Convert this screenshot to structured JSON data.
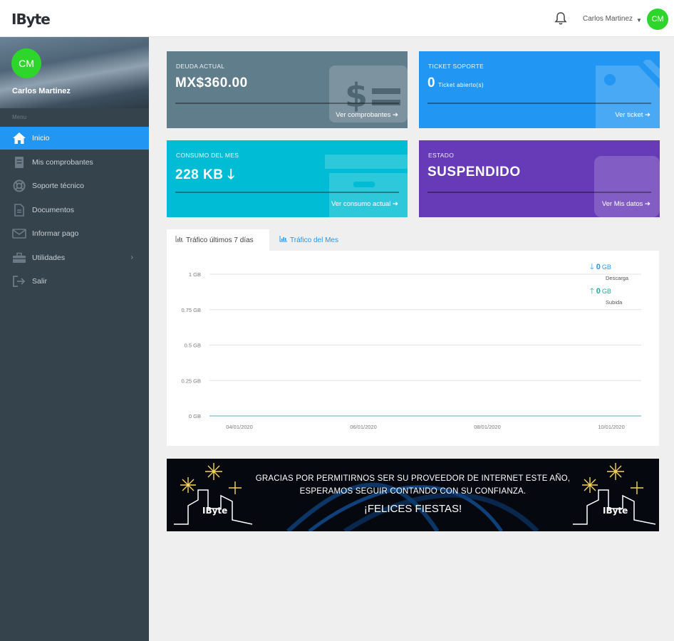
{
  "app": {
    "logo_text": "IByte"
  },
  "header": {
    "user_name": "Carlos Martinez",
    "avatar_initials": "CM"
  },
  "sidebar": {
    "avatar_initials": "CM",
    "user_name": "Carlos Martinez",
    "menu_label": "Menu",
    "items": [
      {
        "label": "Inicio",
        "icon": "home-icon",
        "active": true
      },
      {
        "label": "Mis comprobantes",
        "icon": "receipt-icon",
        "active": false
      },
      {
        "label": "Soporte técnico",
        "icon": "lifebuoy-icon",
        "active": false
      },
      {
        "label": "Documentos",
        "icon": "document-icon",
        "active": false
      },
      {
        "label": "Informar pago",
        "icon": "envelope-icon",
        "active": false
      },
      {
        "label": "Utilidades",
        "icon": "toolbox-icon",
        "active": false
      },
      {
        "label": "Salir",
        "icon": "logout-icon",
        "active": false
      }
    ]
  },
  "cards": {
    "debt": {
      "title": "DEUDA ACTUAL",
      "value": "MX$360.00",
      "link": "Ver comprobantes",
      "color": "#607d8b"
    },
    "ticket": {
      "title": "TICKET SOPORTE",
      "value": "0",
      "sub": "Ticket abierto(s)",
      "link": "Ver ticket",
      "color": "#2196f3"
    },
    "usage": {
      "title": "CONSUMO DEL MES",
      "value": "228 KB",
      "link": "Ver consumo actual",
      "color": "#00bcd4"
    },
    "status": {
      "title": "ESTADO",
      "value": "SUSPENDIDO",
      "link": "Ver Mis datos",
      "color": "#673ab7"
    }
  },
  "tabs": [
    {
      "label": "Tráfico últimos 7 días",
      "active": true
    },
    {
      "label": "Tráfico del Mes",
      "active": false
    }
  ],
  "legend": {
    "download": {
      "value": "0",
      "unit": "GB",
      "caption": "Descarga",
      "color": "#2196f3"
    },
    "upload": {
      "value": "0",
      "unit": "GB",
      "caption": "Subida",
      "color": "#26a69a"
    }
  },
  "chart_data": {
    "type": "line",
    "y_ticks": [
      "1 GB",
      "0.75 GB",
      "0.5 GB",
      "0.25 GB",
      "0 GB"
    ],
    "ylim": [
      0,
      1
    ],
    "x_ticks": [
      "04/01/2020",
      "06/01/2020",
      "08/01/2020",
      "10/01/2020"
    ],
    "grid": true,
    "series": [
      {
        "name": "Descarga",
        "values": [
          0,
          0,
          0,
          0,
          0,
          0,
          0
        ]
      },
      {
        "name": "Subida",
        "values": [
          0,
          0,
          0,
          0,
          0,
          0,
          0
        ]
      }
    ]
  },
  "banner": {
    "line1": "GRACIAS POR PERMITIRNOS SER SU PROVEEDOR DE INTERNET ESTE AÑO,",
    "line2": "ESPERAMOS SEGUIR CONTANDO CON SU CONFIANZA.",
    "line3": "¡FELICES FIESTAS!",
    "logo": "IByte"
  }
}
